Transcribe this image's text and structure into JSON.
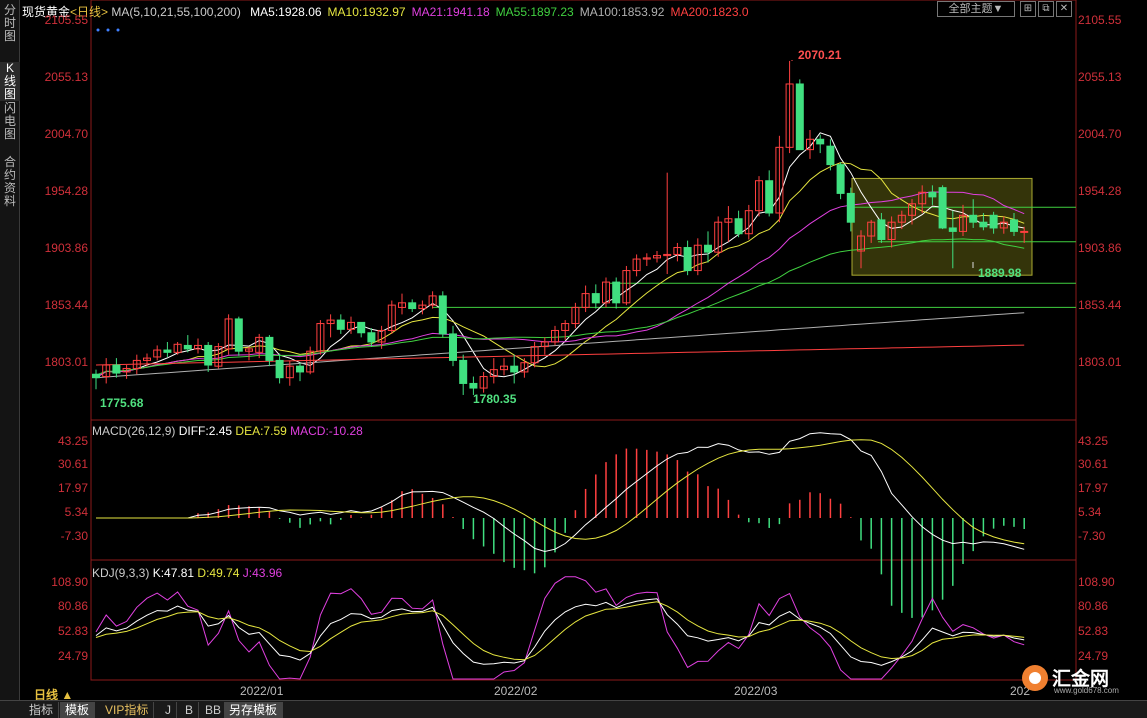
{
  "sidebar": {
    "tabs": [
      {
        "label": "分时图",
        "chars": [
          "分",
          "时",
          "图"
        ],
        "active": false
      },
      {
        "label": "K线图",
        "chars": [
          "K",
          "线",
          "图"
        ],
        "active": true
      },
      {
        "label": "闪电图",
        "chars": [
          "闪",
          "电",
          "图"
        ],
        "active": false
      },
      {
        "label": "合约资料",
        "chars": [
          "合",
          "约",
          "资",
          "料"
        ],
        "active": false
      }
    ]
  },
  "header": {
    "instrument": "现货黄金",
    "period": "<日线>",
    "ma_title": "MA(5,10,21,55,100,200)",
    "ma_values": [
      {
        "label": "MA5:1928.06",
        "color": "#ffffff"
      },
      {
        "label": "MA10:1932.97",
        "color": "#e6e640"
      },
      {
        "label": "MA21:1941.18",
        "color": "#e040e0"
      },
      {
        "label": "MA55:1897.23",
        "color": "#40d040"
      },
      {
        "label": "MA100:1853.92",
        "color": "#b0b0b0"
      },
      {
        "label": "MA200:1823.0",
        "color": "#ff4040"
      }
    ],
    "theme_button": "全部主题▼",
    "window_buttons": [
      "⊞",
      "⧉",
      "✕"
    ]
  },
  "price_axis": {
    "labels": [
      "2105.55",
      "2055.13",
      "2004.70",
      "1954.28",
      "1903.86",
      "1853.44",
      "1803.01"
    ],
    "min": 1760,
    "max": 2105.55
  },
  "annotations": {
    "high": "2070.21",
    "low1": "1775.68",
    "low2": "1780.35",
    "low3": "1889.98"
  },
  "macd": {
    "title": "MACD(26,12,9)",
    "diff": "DIFF:2.45",
    "dea": "DEA:7.59",
    "macd": "MACD:-10.28",
    "axis": [
      "43.25",
      "30.61",
      "17.97",
      "5.34",
      "-7.30"
    ]
  },
  "kdj": {
    "title": "KDJ(9,3,3)",
    "k": "K:47.81",
    "d": "D:49.74",
    "j": "J:43.96",
    "axis": [
      "108.90",
      "80.86",
      "52.83",
      "24.79"
    ]
  },
  "time_axis": [
    "2022/01",
    "2022/02",
    "2022/03",
    "202"
  ],
  "period_selector": "日线 ▲",
  "bottom_tabs": [
    {
      "label": "指标",
      "active": false
    },
    {
      "label": "模板",
      "active": true
    },
    {
      "label": "VIP指标",
      "active": false
    },
    {
      "label": "J",
      "active": false
    },
    {
      "label": "B",
      "active": false
    },
    {
      "label": "BB",
      "active": false
    },
    {
      "label": "另存模板",
      "active": true
    }
  ],
  "logo": {
    "name": "汇金网",
    "url": "www.gold678.com"
  },
  "colors": {
    "up": "#ff4040",
    "down": "#40e080",
    "axis": "#d0303a"
  },
  "chart_data": {
    "type": "candlestick",
    "title": "现货黄金 <日线>",
    "ylim": [
      1760,
      2105.55
    ],
    "candles": [
      [
        1798,
        1802,
        1785,
        1795
      ],
      [
        1796,
        1812,
        1790,
        1806
      ],
      [
        1806,
        1812,
        1795,
        1799
      ],
      [
        1800,
        1806,
        1794,
        1803
      ],
      [
        1803,
        1815,
        1798,
        1810
      ],
      [
        1810,
        1816,
        1805,
        1812
      ],
      [
        1813,
        1823,
        1810,
        1819
      ],
      [
        1819,
        1826,
        1813,
        1817
      ],
      [
        1817,
        1826,
        1815,
        1824
      ],
      [
        1823,
        1832,
        1817,
        1820
      ],
      [
        1820,
        1829,
        1816,
        1823
      ],
      [
        1823,
        1826,
        1800,
        1806
      ],
      [
        1805,
        1825,
        1803,
        1822
      ],
      [
        1820,
        1850,
        1815,
        1846
      ],
      [
        1846,
        1848,
        1814,
        1818
      ],
      [
        1818,
        1822,
        1810,
        1820
      ],
      [
        1817,
        1833,
        1812,
        1830
      ],
      [
        1830,
        1832,
        1805,
        1810
      ],
      [
        1810,
        1816,
        1790,
        1795
      ],
      [
        1795,
        1810,
        1788,
        1805
      ],
      [
        1805,
        1808,
        1792,
        1800
      ],
      [
        1800,
        1822,
        1798,
        1818
      ],
      [
        1818,
        1845,
        1815,
        1842
      ],
      [
        1842,
        1850,
        1830,
        1845
      ],
      [
        1845,
        1850,
        1833,
        1837
      ],
      [
        1837,
        1848,
        1833,
        1843
      ],
      [
        1843,
        1843,
        1830,
        1834
      ],
      [
        1834,
        1838,
        1822,
        1826
      ],
      [
        1826,
        1840,
        1820,
        1836
      ],
      [
        1836,
        1862,
        1833,
        1858
      ],
      [
        1856,
        1868,
        1850,
        1860
      ],
      [
        1860,
        1863,
        1852,
        1855
      ],
      [
        1855,
        1862,
        1850,
        1858
      ],
      [
        1858,
        1870,
        1855,
        1866
      ],
      [
        1866,
        1870,
        1830,
        1833
      ],
      [
        1833,
        1840,
        1805,
        1810
      ],
      [
        1810,
        1815,
        1780,
        1790
      ],
      [
        1790,
        1796,
        1780,
        1786
      ],
      [
        1786,
        1800,
        1782,
        1796
      ],
      [
        1796,
        1812,
        1790,
        1802
      ],
      [
        1802,
        1812,
        1797,
        1805
      ],
      [
        1805,
        1815,
        1790,
        1800
      ],
      [
        1800,
        1812,
        1795,
        1808
      ],
      [
        1808,
        1826,
        1804,
        1822
      ],
      [
        1822,
        1830,
        1815,
        1826
      ],
      [
        1826,
        1840,
        1823,
        1836
      ],
      [
        1836,
        1845,
        1828,
        1842
      ],
      [
        1842,
        1860,
        1838,
        1856
      ],
      [
        1856,
        1875,
        1852,
        1868
      ],
      [
        1868,
        1876,
        1855,
        1860
      ],
      [
        1860,
        1882,
        1856,
        1878
      ],
      [
        1878,
        1882,
        1855,
        1860
      ],
      [
        1860,
        1892,
        1858,
        1888
      ],
      [
        1888,
        1902,
        1883,
        1898
      ],
      [
        1898,
        1903,
        1892,
        1899
      ],
      [
        1899,
        1905,
        1895,
        1901
      ],
      [
        1901,
        1973,
        1885,
        1902
      ],
      [
        1902,
        1912,
        1896,
        1908
      ],
      [
        1908,
        1914,
        1884,
        1888
      ],
      [
        1888,
        1916,
        1884,
        1910
      ],
      [
        1910,
        1922,
        1895,
        1904
      ],
      [
        1904,
        1935,
        1900,
        1930
      ],
      [
        1930,
        1944,
        1913,
        1933
      ],
      [
        1933,
        1940,
        1917,
        1920
      ],
      [
        1920,
        1945,
        1915,
        1940
      ],
      [
        1940,
        1970,
        1935,
        1966
      ],
      [
        1966,
        1975,
        1935,
        1938
      ],
      [
        1938,
        2005,
        1930,
        1995
      ],
      [
        1995,
        2070,
        1990,
        2050
      ],
      [
        2050,
        2054,
        1995,
        1993
      ],
      [
        1993,
        2010,
        1985,
        2002
      ],
      [
        2002,
        2006,
        1990,
        1998
      ],
      [
        1996,
        2002,
        1975,
        1980
      ],
      [
        1980,
        1982,
        1950,
        1955
      ],
      [
        1955,
        1960,
        1922,
        1930
      ],
      [
        1905,
        1923,
        1890,
        1918
      ],
      [
        1918,
        1932,
        1912,
        1930
      ],
      [
        1932,
        1938,
        1912,
        1915
      ],
      [
        1915,
        1935,
        1908,
        1930
      ],
      [
        1930,
        1940,
        1924,
        1936
      ],
      [
        1936,
        1950,
        1928,
        1946
      ],
      [
        1946,
        1962,
        1938,
        1956
      ],
      [
        1956,
        1962,
        1945,
        1952
      ],
      [
        1960,
        1962,
        1924,
        1925
      ],
      [
        1925,
        1940,
        1890,
        1922
      ],
      [
        1922,
        1945,
        1918,
        1936
      ],
      [
        1936,
        1950,
        1925,
        1930
      ],
      [
        1930,
        1938,
        1923,
        1926
      ],
      [
        1936,
        1939,
        1920,
        1925
      ],
      [
        1925,
        1935,
        1920,
        1930
      ],
      [
        1932,
        1938,
        1918,
        1922
      ],
      [
        1922,
        1926,
        1912,
        1922
      ]
    ]
  }
}
